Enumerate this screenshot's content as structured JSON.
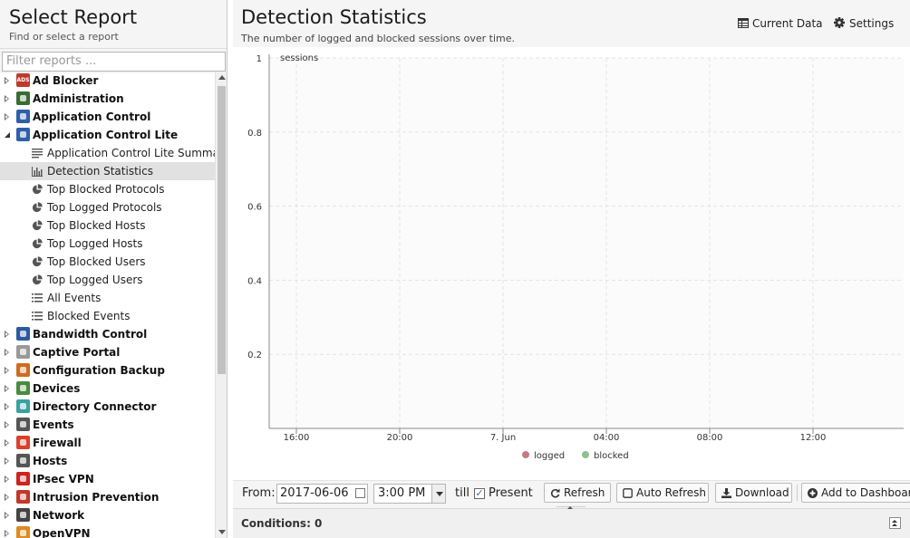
{
  "left": {
    "title": "Select Report",
    "subtitle": "Find or select a report",
    "filter_placeholder": "Filter reports ..."
  },
  "tree": [
    {
      "type": "app",
      "label": "Ad Blocker",
      "icon": "ad-blocker-icon",
      "color": "#c0392b",
      "text": "ADS",
      "expanded": false
    },
    {
      "type": "app",
      "label": "Administration",
      "icon": "administration-icon",
      "color": "#3a6b35",
      "expanded": false
    },
    {
      "type": "app",
      "label": "Application Control",
      "icon": "application-control-icon",
      "color": "#2f5fa8",
      "expanded": false
    },
    {
      "type": "app",
      "label": "Application Control Lite",
      "icon": "application-control-lite-icon",
      "color": "#2f5fa8",
      "expanded": true
    },
    {
      "type": "report",
      "label": "Application Control Lite Summary",
      "icon": "text-lines-icon"
    },
    {
      "type": "report",
      "label": "Detection Statistics",
      "icon": "bar-chart-icon",
      "selected": true
    },
    {
      "type": "report",
      "label": "Top Blocked Protocols",
      "icon": "pie-chart-icon"
    },
    {
      "type": "report",
      "label": "Top Logged Protocols",
      "icon": "pie-chart-icon"
    },
    {
      "type": "report",
      "label": "Top Blocked Hosts",
      "icon": "pie-chart-icon"
    },
    {
      "type": "report",
      "label": "Top Logged Hosts",
      "icon": "pie-chart-icon"
    },
    {
      "type": "report",
      "label": "Top Blocked Users",
      "icon": "pie-chart-icon"
    },
    {
      "type": "report",
      "label": "Top Logged Users",
      "icon": "pie-chart-icon"
    },
    {
      "type": "report",
      "label": "All Events",
      "icon": "list-icon"
    },
    {
      "type": "report",
      "label": "Blocked Events",
      "icon": "list-icon"
    },
    {
      "type": "app",
      "label": "Bandwidth Control",
      "icon": "bandwidth-control-icon",
      "color": "#2b5aa0",
      "expanded": false
    },
    {
      "type": "app",
      "label": "Captive Portal",
      "icon": "captive-portal-icon",
      "color": "#999999",
      "expanded": false
    },
    {
      "type": "app",
      "label": "Configuration Backup",
      "icon": "configuration-backup-icon",
      "color": "#d06b1e",
      "expanded": false
    },
    {
      "type": "app",
      "label": "Devices",
      "icon": "devices-icon",
      "color": "#4a8a3e",
      "expanded": false
    },
    {
      "type": "app",
      "label": "Directory Connector",
      "icon": "directory-connector-icon",
      "color": "#3aa0a0",
      "expanded": false
    },
    {
      "type": "app",
      "label": "Events",
      "icon": "events-icon",
      "color": "#555555",
      "expanded": false
    },
    {
      "type": "app",
      "label": "Firewall",
      "icon": "firewall-icon",
      "color": "#d9412b",
      "expanded": false
    },
    {
      "type": "app",
      "label": "Hosts",
      "icon": "hosts-icon",
      "color": "#555555",
      "expanded": false
    },
    {
      "type": "app",
      "label": "IPsec VPN",
      "icon": "ipsec-vpn-icon",
      "color": "#cc2222",
      "expanded": false
    },
    {
      "type": "app",
      "label": "Intrusion Prevention",
      "icon": "intrusion-prevention-icon",
      "color": "#c0392b",
      "expanded": false
    },
    {
      "type": "app",
      "label": "Network",
      "icon": "network-icon",
      "color": "#444444",
      "expanded": false
    },
    {
      "type": "app",
      "label": "OpenVPN",
      "icon": "openvpn-icon",
      "color": "#e08a1e",
      "expanded": false
    }
  ],
  "report": {
    "title": "Detection Statistics",
    "subtitle": "The number of logged and blocked sessions over time.",
    "current_data_label": "Current Data",
    "settings_label": "Settings"
  },
  "chart_data": {
    "type": "line",
    "ylabel": "sessions",
    "ylim": [
      0,
      1
    ],
    "yticks": [
      "1",
      "0.8",
      "0.6",
      "0.4",
      "0.2"
    ],
    "xticks": [
      "16:00",
      "20:00",
      "7. Jun",
      "04:00",
      "08:00",
      "12:00"
    ],
    "series": [
      {
        "name": "logged",
        "color": "#c27b84",
        "values": []
      },
      {
        "name": "blocked",
        "color": "#8fbf8f",
        "values": []
      }
    ],
    "grid": true,
    "legend": "bottom"
  },
  "toolbar": {
    "from_label": "From:",
    "date": "2017-06-06",
    "time": "3:00 PM",
    "till_label": "till",
    "present_checked": "✓",
    "present_label": "Present",
    "refresh_label": "Refresh",
    "auto_refresh_label": "Auto Refresh",
    "download_label": "Download",
    "dashboard_label": "Add to Dashboard"
  },
  "conditions": {
    "label": "Conditions: 0"
  }
}
